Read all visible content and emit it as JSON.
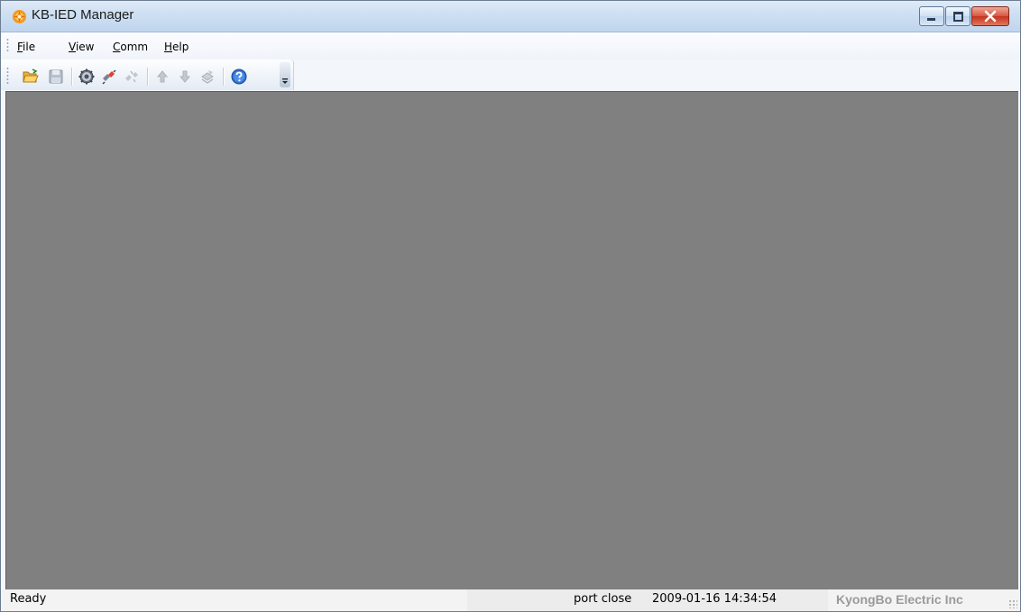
{
  "window": {
    "title": "KB-IED Manager"
  },
  "menubar": {
    "items": [
      {
        "id": "file",
        "mnemonic": "F",
        "rest": "ile"
      },
      {
        "id": "view",
        "mnemonic": "V",
        "rest": "iew"
      },
      {
        "id": "comm",
        "mnemonic": "C",
        "rest": "omm"
      },
      {
        "id": "help",
        "mnemonic": "H",
        "rest": "elp"
      }
    ]
  },
  "toolbar": {
    "buttons": [
      "open-folder-icon",
      "save-icon",
      "settings-gear-icon",
      "connect-icon",
      "disconnect-icon",
      "upload-arrow-icon",
      "download-arrow-icon",
      "write-device-icon",
      "help-icon"
    ]
  },
  "statusbar": {
    "ready": "Ready",
    "port_status": "port close",
    "datetime": "2009-01-16 14:34:54",
    "company": "KyongBo Electric Inc"
  },
  "colors": {
    "client_background": "#808080",
    "titlebar": "#cddff2",
    "close_button": "#c5331c",
    "company_text": "#9a9a9a"
  }
}
